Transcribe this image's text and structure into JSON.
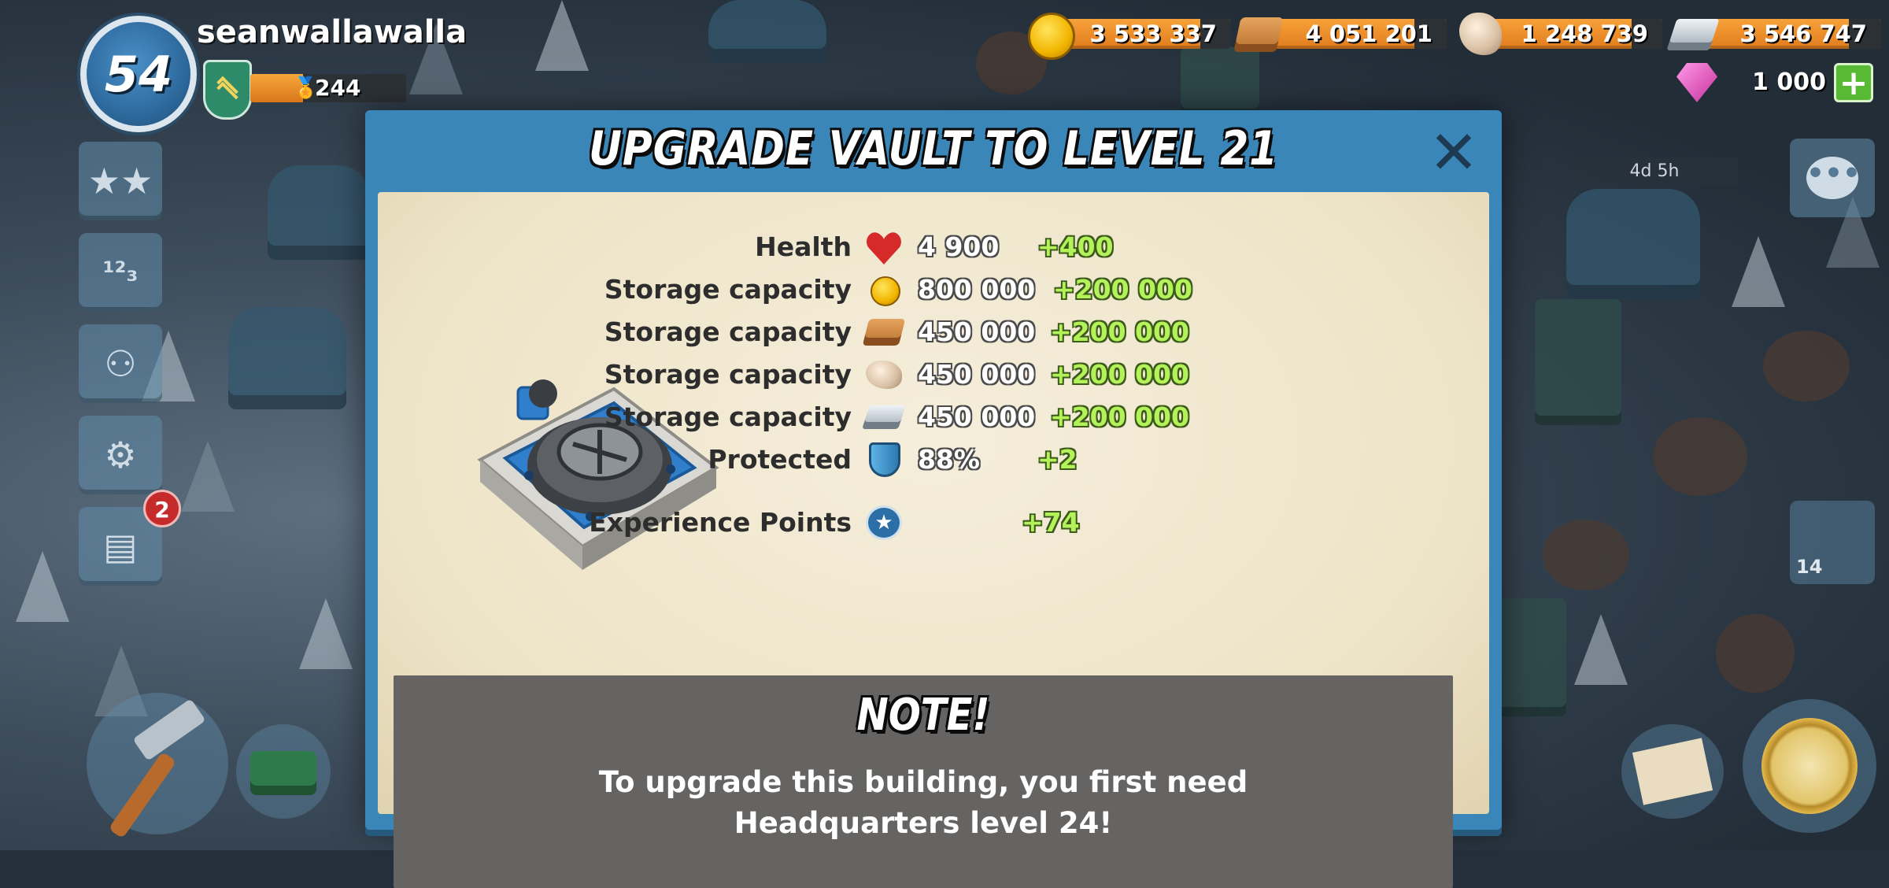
{
  "player": {
    "level": "54",
    "name": "seanwallawalla",
    "rank_value": "244",
    "rank_progress": 0.34
  },
  "resources": [
    {
      "name": "gold",
      "icon": "gold-coin-icon",
      "value": "3 533 337"
    },
    {
      "name": "wood",
      "icon": "wood-icon",
      "value": "4 051 201"
    },
    {
      "name": "stone",
      "icon": "stone-icon",
      "value": "1 248 739"
    },
    {
      "name": "iron",
      "icon": "iron-icon",
      "value": "3 546 747"
    }
  ],
  "gems": {
    "value": "1 000",
    "add_label": "+"
  },
  "sidebar": {
    "news_badge": "2"
  },
  "timer": {
    "label": "4d 5h"
  },
  "troops": {
    "count": "14"
  },
  "dialog": {
    "title": "UPGRADE VAULT TO LEVEL 21",
    "close_label": "✕",
    "stats": [
      {
        "label": "Health",
        "icon": "heart-icon",
        "value": "4 900",
        "bonus": "+400"
      },
      {
        "label": "Storage capacity",
        "icon": "gold-coin-icon",
        "value": "800 000",
        "bonus": "+200 000"
      },
      {
        "label": "Storage capacity",
        "icon": "wood-icon",
        "value": "450 000",
        "bonus": "+200 000"
      },
      {
        "label": "Storage capacity",
        "icon": "stone-icon",
        "value": "450 000",
        "bonus": "+200 000"
      },
      {
        "label": "Storage capacity",
        "icon": "iron-icon",
        "value": "450 000",
        "bonus": "+200 000"
      },
      {
        "label": "Protected",
        "icon": "shield-icon",
        "value": "88%",
        "bonus": "+2"
      },
      {
        "label": "Experience Points",
        "icon": "xp-star-icon",
        "value": "",
        "bonus": "+74"
      }
    ],
    "note": {
      "title": "NOTE!",
      "line1": "To upgrade this building, you first need",
      "line2": "Headquarters level 24!"
    }
  },
  "colors": {
    "dialog_frame": "#3a86b8",
    "parchment": "#efe6cb",
    "bonus_green": "#b4f25a",
    "resource_bar": "#f2952e"
  }
}
